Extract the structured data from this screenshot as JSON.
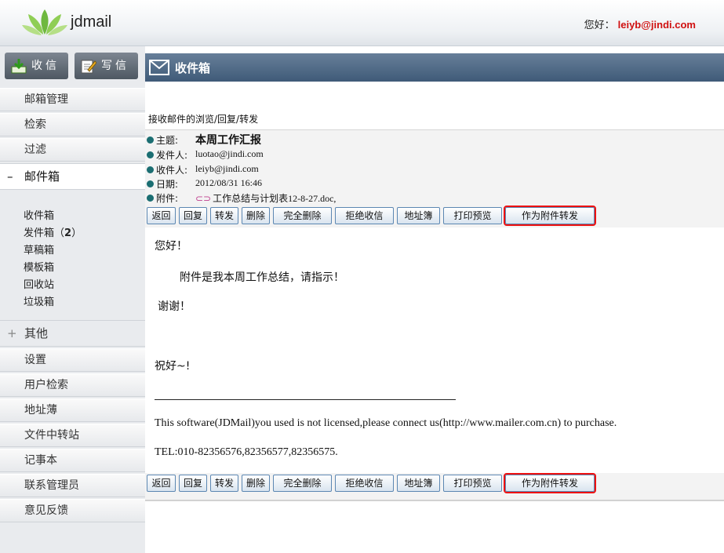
{
  "header": {
    "brand": "jdmail",
    "greeting": "您好：",
    "user": "leiyb@jindi.com",
    "logo_color": "#7cc24a"
  },
  "sidebar": {
    "receive_label": "收信",
    "compose_label": "写信",
    "items_top": [
      "邮箱管理",
      "检索",
      "过滤"
    ],
    "mailbox_label": "邮件箱",
    "mailbox_sign": "–",
    "folders": [
      {
        "name": "收件箱",
        "count": ""
      },
      {
        "name": "发件箱",
        "count": "2"
      },
      {
        "name": "草稿箱",
        "count": ""
      },
      {
        "name": "模板箱",
        "count": ""
      },
      {
        "name": "回收站",
        "count": ""
      },
      {
        "name": "垃圾箱",
        "count": ""
      }
    ],
    "other_label": "其他",
    "other_sign": "+",
    "items_bottom": [
      "设置",
      "用户检索",
      "地址薄",
      "文件中转站",
      "记事本",
      "联系管理员",
      "意见反馈"
    ]
  },
  "main": {
    "title": "收件箱",
    "breadcrumb": "接收邮件的浏览/回复/转发",
    "fields": {
      "subject_label": "主题:",
      "subject": "本周工作汇报",
      "from_label": "发件人:",
      "from": "luotao@jindi.com",
      "to_label": "收件人:",
      "to": "leiyb@jindi.com",
      "date_label": "日期:",
      "date": "2012/08/31 16:46",
      "attach_label": "附件:",
      "attachment": "工作总结与计划表12-8-27.doc,"
    },
    "toolbar": [
      "返回",
      "回复",
      "转发",
      "删除",
      "完全删除",
      "拒绝收信",
      "地址簿",
      "打印预览",
      "作为附件转发"
    ],
    "body": {
      "greeting": "您好！",
      "line1": "附件是我本周工作总结，请指示！",
      "thanks": "谢谢！",
      "closing": "祝好~!",
      "notice": "This software(JDMail)you used is not licensed,please connect us(http://www.mailer.com.cn) to purchase.",
      "tel": "TEL:010-82356576,82356577,82356575."
    }
  }
}
